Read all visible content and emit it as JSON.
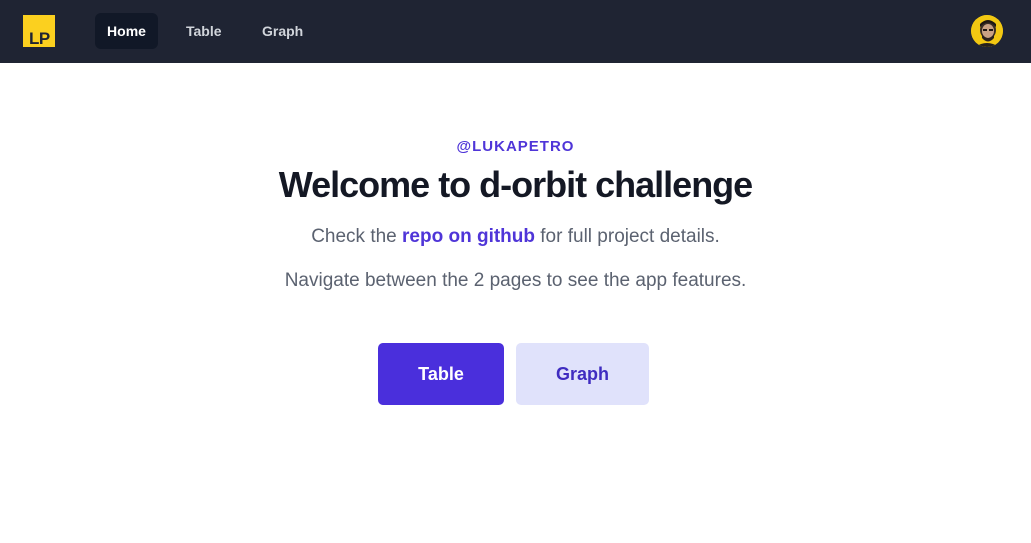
{
  "colors": {
    "nav_bg": "#1f2433",
    "accent": "#4f35d8",
    "logo_bg": "#fbd01f",
    "secondary_btn_bg": "#e0e2fb"
  },
  "nav": {
    "logo_text": "LP",
    "links": [
      {
        "label": "Home",
        "active": true
      },
      {
        "label": "Table",
        "active": false
      },
      {
        "label": "Graph",
        "active": false
      }
    ],
    "avatar_icon": "user-avatar-icon"
  },
  "hero": {
    "eyebrow": "@LUKAPETRO",
    "title": "Welcome to d-orbit challenge",
    "line1_prefix": "Check the ",
    "line1_link": "repo on github",
    "line1_suffix": " for full project details.",
    "line2": "Navigate between the 2 pages to see the app features.",
    "primary_button": "Table",
    "secondary_button": "Graph"
  }
}
